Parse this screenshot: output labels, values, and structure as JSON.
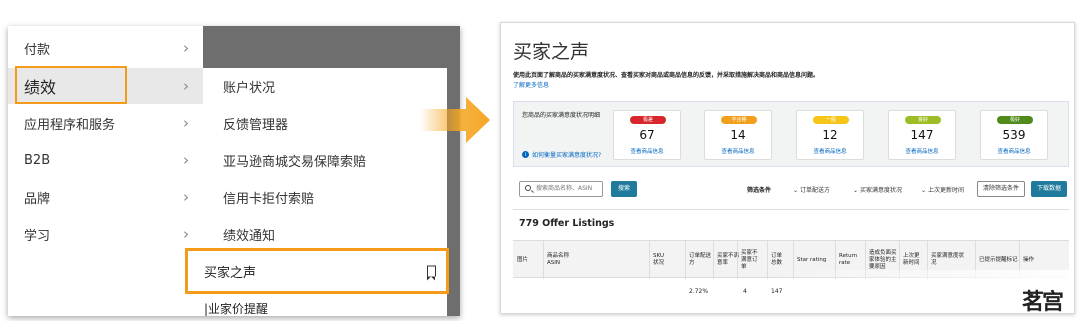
{
  "left_menu": {
    "items": [
      {
        "label": "付款"
      },
      {
        "label": "绩效"
      },
      {
        "label": "应用程序和服务"
      },
      {
        "label": "B2B"
      },
      {
        "label": "品牌"
      },
      {
        "label": "学习"
      }
    ],
    "chevron": "›",
    "submenu": [
      {
        "label": "账户状况"
      },
      {
        "label": "反馈管理器"
      },
      {
        "label": "亚马逊商城交易保障索赔"
      },
      {
        "label": "信用卡拒付索赔"
      },
      {
        "label": "绩效通知"
      }
    ],
    "highlighted_item": "买家之声",
    "cut_item": "|业家价提醒"
  },
  "voc_page": {
    "title": "买家之声",
    "description": "使用此页面了解商品的买家满意度状况、查看买家对商品或商品信息的反馈，并采取措施解决商品和商品信息问题。",
    "learn_more": "了解更多信息",
    "summary_label": "您商品的买家满意度状况明细",
    "help_link": "如何衡量买家满意度状况?",
    "cards": [
      {
        "status": "极差",
        "count": "67",
        "link": "查看商品信息",
        "color": "#d9262c"
      },
      {
        "status": "不合格",
        "count": "14",
        "link": "查看商品信息",
        "color": "#f0a11c"
      },
      {
        "status": "一般",
        "count": "12",
        "link": "查看商品信息",
        "color": "#f5c518"
      },
      {
        "status": "良好",
        "count": "147",
        "link": "查看商品信息",
        "color": "#9dbd26"
      },
      {
        "status": "极好",
        "count": "539",
        "link": "查看商品信息",
        "color": "#4f8a1a"
      }
    ],
    "search_placeholder": "搜索商品名称、ASIN",
    "search_button": "搜索",
    "filter_label": "筛选条件",
    "filters": [
      "订单配送方",
      "买家满意度状况",
      "上次更新时间"
    ],
    "clear_button": "清除筛选条件",
    "download_button": "下载数据",
    "listings_title": "779 Offer Listings",
    "columns": [
      "图片",
      "商品名称\nASIN",
      "SKU\n状况",
      "订单配送\n方",
      "买家不满\n意率",
      "买家不\n满意订\n单",
      "订单\n总数",
      "Star rating",
      "Return\nrate",
      "造成负面买\n家体验的主\n要原因",
      "上次更\n新时间",
      "买家满意度状\n况",
      "已提示提醒标记",
      "操作"
    ],
    "row": {
      "dsr": "2.72%",
      "orders_bad": "4",
      "orders_total": "147"
    }
  },
  "watermark": "茗宫",
  "colors": {
    "highlight": "#f59b1c",
    "arrow": "#f5a623",
    "link": "#0066c0",
    "button": "#1f7a9c"
  }
}
